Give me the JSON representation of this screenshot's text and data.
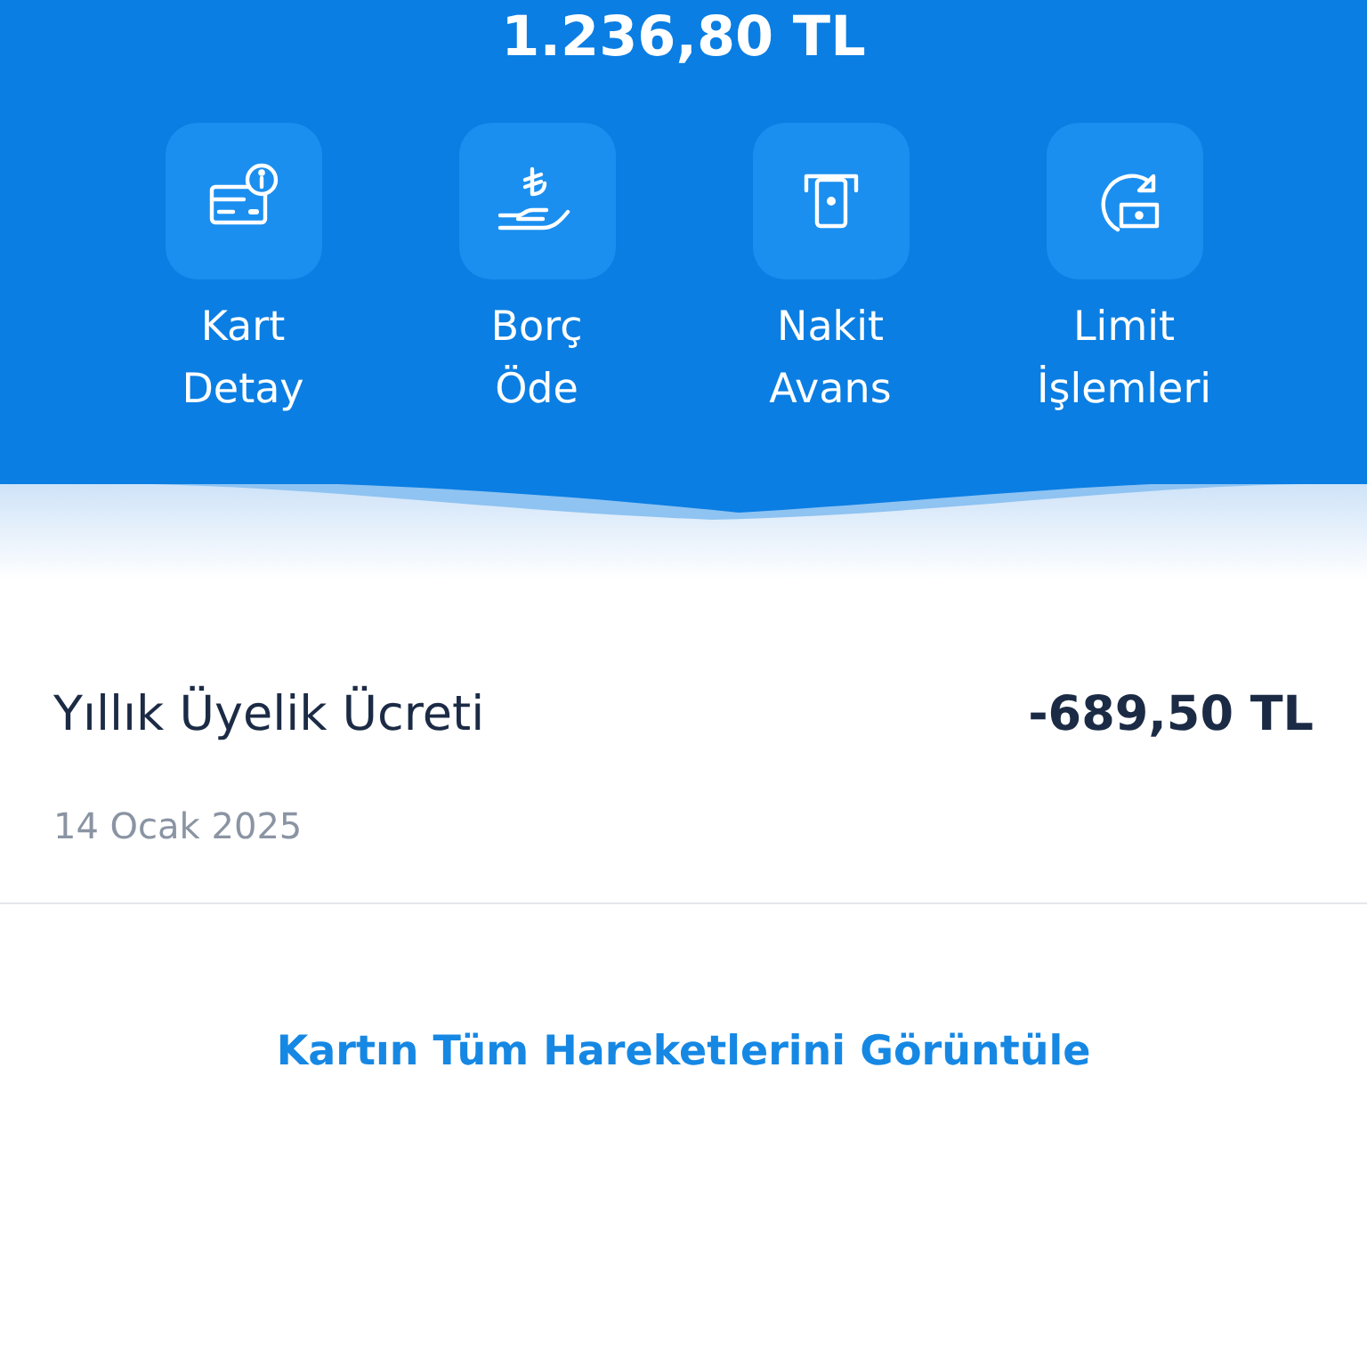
{
  "balance": {
    "amount": "1.236,80 TL"
  },
  "actions": [
    {
      "label": "Kart\nDetay"
    },
    {
      "label": "Borç\nÖde"
    },
    {
      "label": "Nakit\nAvans"
    },
    {
      "label": "Limit\nİşlemleri"
    }
  ],
  "transactions": [
    {
      "title": "Yıllık Üyelik Ücreti",
      "amount": "-689,50 TL",
      "date": "14 Ocak 2025"
    }
  ],
  "link": "Kartın Tüm Hareketlerini Görüntüle"
}
